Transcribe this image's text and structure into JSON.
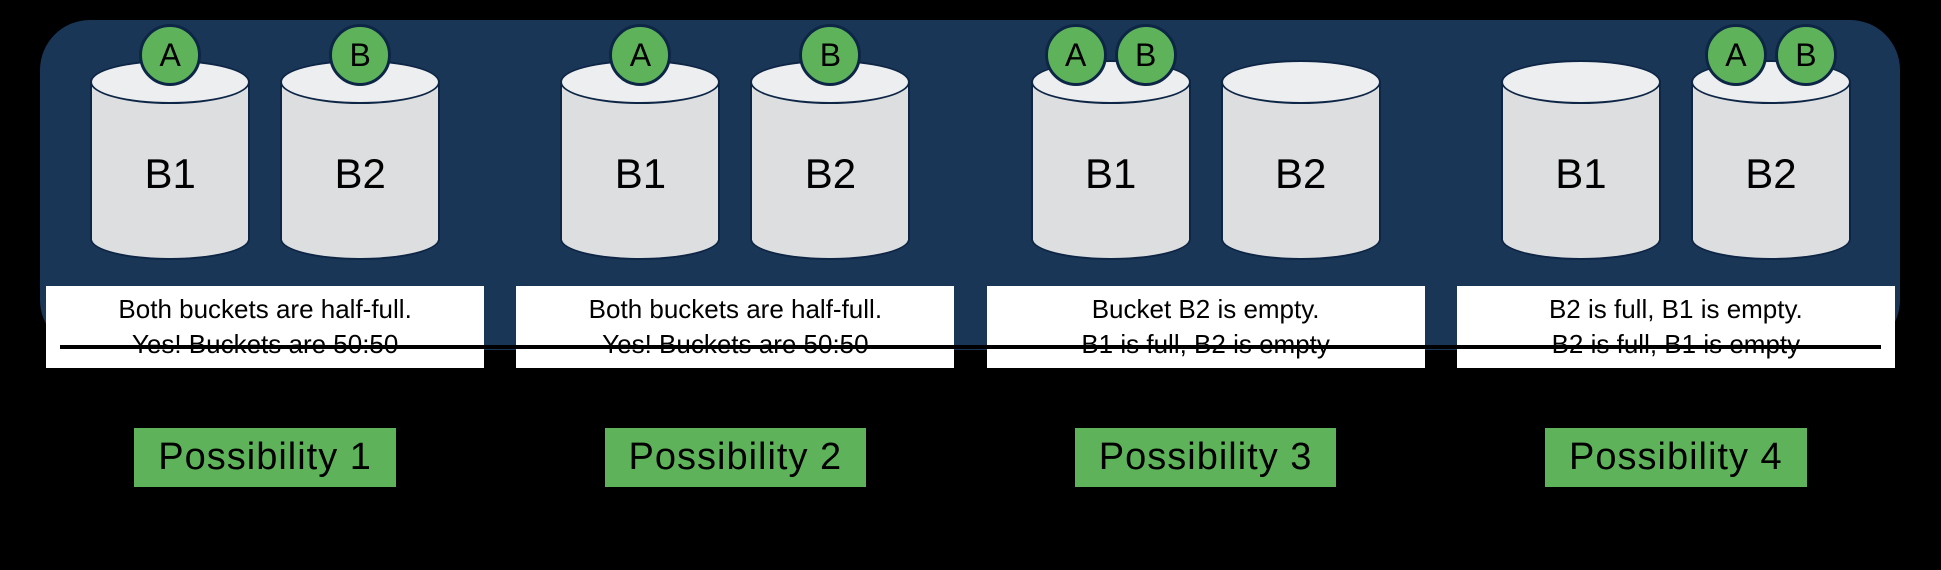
{
  "colors": {
    "bg": "#000000",
    "panel": "#1a3657",
    "bucket_fill": "#dcdee0",
    "bucket_top": "#eceef0",
    "ball": "#5eb35a",
    "tag": "#5eb35a"
  },
  "buckets": {
    "b1": "B1",
    "b2": "B2"
  },
  "balls": {
    "a": "A",
    "b": "B"
  },
  "possibilities": [
    {
      "label": "Possibility 1",
      "caption_line1": "Both buckets are half-full.",
      "caption_line2": "Yes! Buckets are 50:50",
      "b1_balls": [
        "a"
      ],
      "b2_balls": [
        "b"
      ]
    },
    {
      "label": "Possibility 2",
      "caption_line1": "Both buckets are half-full.",
      "caption_line2": "Yes! Buckets are 50:50",
      "b1_balls": [
        "a"
      ],
      "b2_balls": [
        "b"
      ]
    },
    {
      "label": "Possibility 3",
      "caption_line1": "Bucket B2 is empty.",
      "caption_line2": "B1 is full, B2 is empty",
      "b1_balls": [
        "a",
        "b"
      ],
      "b2_balls": []
    },
    {
      "label": "Possibility 4",
      "caption_line1": "B2 is full, B1 is empty.",
      "caption_line2": "B2 is full, B1 is empty",
      "b1_balls": [],
      "b2_balls": [
        "a",
        "b"
      ]
    }
  ]
}
